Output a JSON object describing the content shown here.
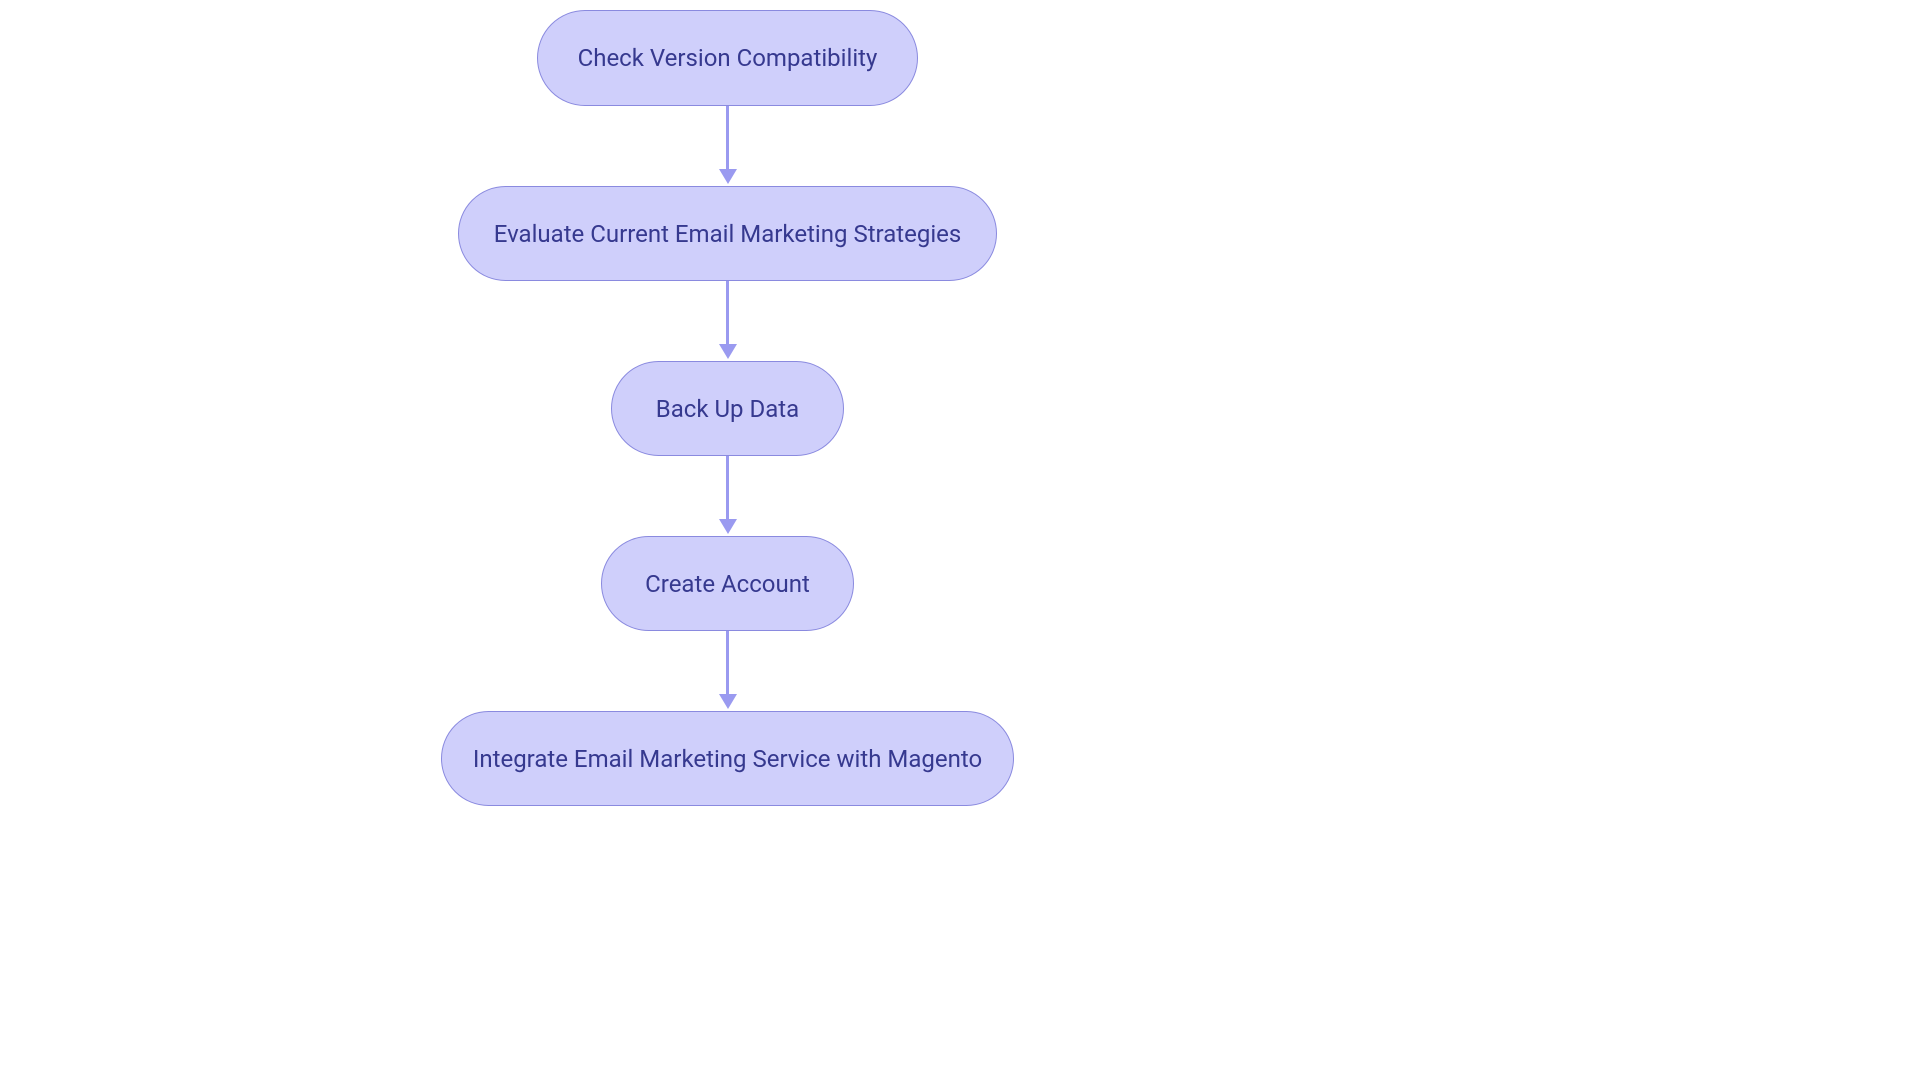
{
  "diagram": {
    "type": "flowchart",
    "direction": "top-to-bottom",
    "colors": {
      "node_fill": "#cfcffb",
      "node_border": "#8a8adf",
      "node_text": "#36398f",
      "connector": "#9a9af0",
      "background": "#ffffff"
    },
    "nodes": [
      {
        "id": "n1",
        "label": "Check Version Compatibility"
      },
      {
        "id": "n2",
        "label": "Evaluate Current Email Marketing Strategies"
      },
      {
        "id": "n3",
        "label": "Back Up Data"
      },
      {
        "id": "n4",
        "label": "Create Account"
      },
      {
        "id": "n5",
        "label": "Integrate Email Marketing Service with Magento"
      }
    ],
    "edges": [
      {
        "from": "n1",
        "to": "n2"
      },
      {
        "from": "n2",
        "to": "n3"
      },
      {
        "from": "n3",
        "to": "n4"
      },
      {
        "from": "n4",
        "to": "n5"
      }
    ]
  }
}
